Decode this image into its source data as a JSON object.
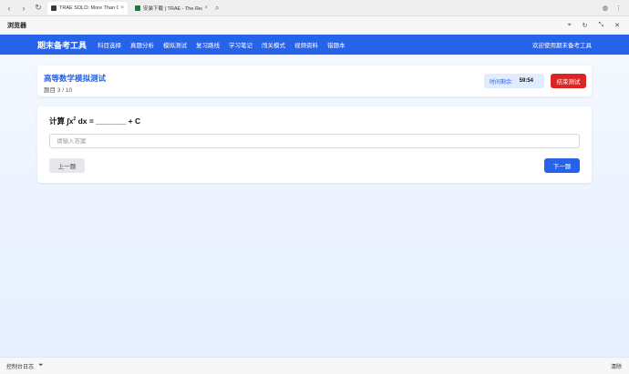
{
  "browser": {
    "tabs": [
      {
        "title": "TRAE SOLO: More Than Co",
        "favicon_color": "#3a3a3a"
      },
      {
        "title": "安装下载 | TRAE - The Real AI En",
        "favicon_color": "#1f7a3a"
      }
    ],
    "app_title": "浏览器"
  },
  "site": {
    "brand": "期末备考工具",
    "nav": [
      "科目选择",
      "真题分析",
      "模拟测试",
      "复习路线",
      "学习笔记",
      "闯关模式",
      "视频资料",
      "错题本"
    ],
    "welcome": "欢迎使用期末备考工具"
  },
  "exam": {
    "title": "高等数学模拟测试",
    "progress": "题目 3 / 10",
    "timer_label": "时间剩余:",
    "timer_value": "59:54",
    "end_label": "结束测试"
  },
  "question": {
    "prefix": "计算 ∫x",
    "sup": "2",
    "suffix": " dx = _______ + C",
    "answer_placeholder": "请输入答案",
    "answer_value": "",
    "prev_label": "上一题",
    "next_label": "下一题"
  },
  "statusbar": {
    "console_label": "控制台日志",
    "clear_label": "清除"
  },
  "colors": {
    "primary": "#2563eb",
    "danger": "#dc2626"
  }
}
